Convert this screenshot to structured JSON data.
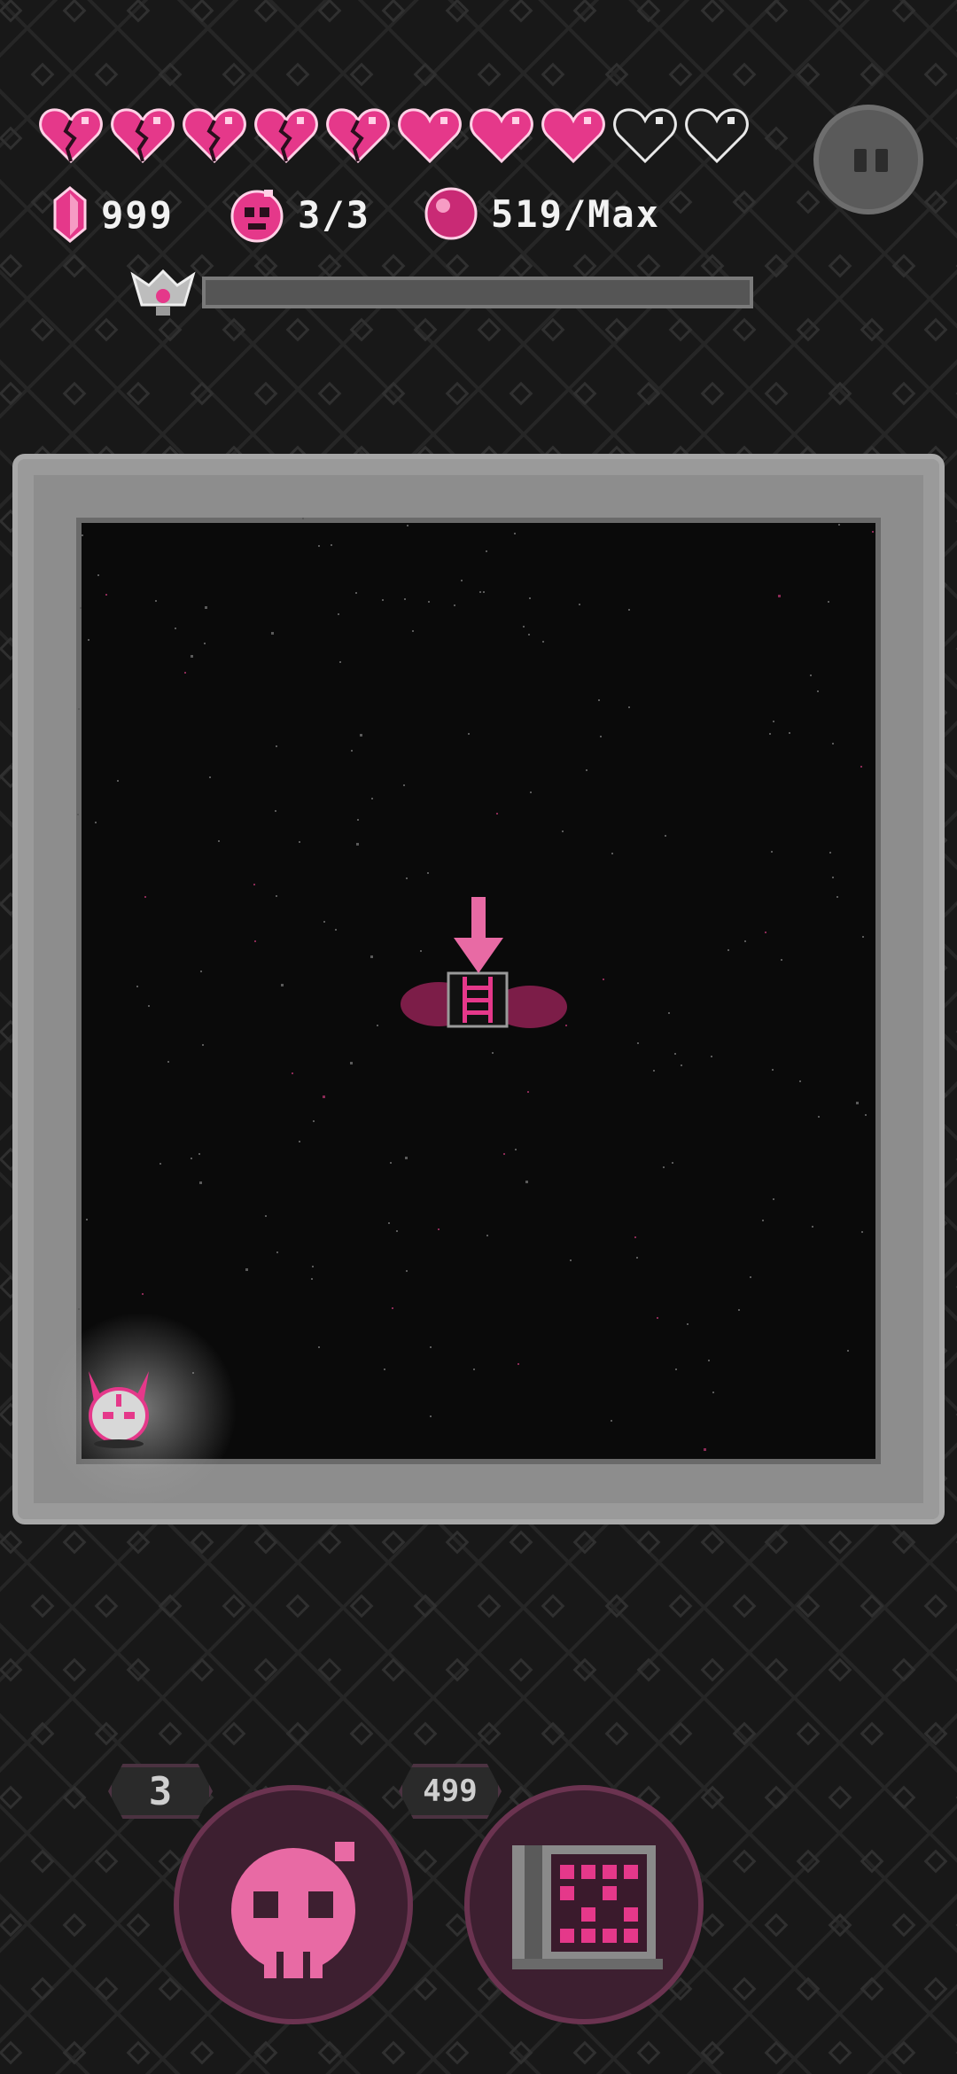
{
  "hud": {
    "hearts": [
      "broken",
      "broken",
      "broken",
      "broken",
      "broken",
      "full",
      "full",
      "full",
      "empty",
      "empty"
    ],
    "gems": "999",
    "bombs": "3/3",
    "orbs": "519/Max",
    "boss_progress": 0,
    "pause_icon": "pause-icon"
  },
  "controls": {
    "bomb_count": "3",
    "map_cost": "499"
  },
  "colors": {
    "accent": "#e5388a",
    "accent_dark": "#7c1d48",
    "wall": "#8d8d8d",
    "floor": "#0a0a0a"
  }
}
